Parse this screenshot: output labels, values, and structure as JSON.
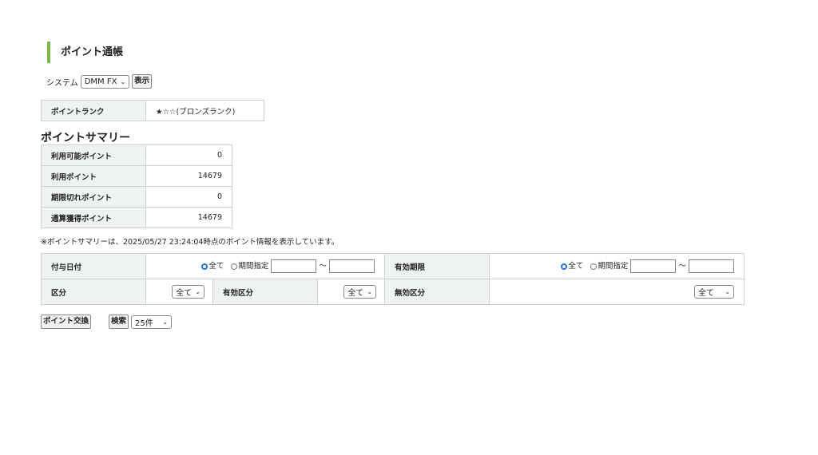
{
  "page_title": "ポイント通帳",
  "system": {
    "label": "システム",
    "selected": "DMM FX",
    "show_button": "表示"
  },
  "rank": {
    "label": "ポイントランク",
    "value": "★☆☆(ブロンズランク)"
  },
  "summary": {
    "title": "ポイントサマリー",
    "rows": [
      {
        "label": "利用可能ポイント",
        "value": "0"
      },
      {
        "label": "利用ポイント",
        "value": "14679"
      },
      {
        "label": "期限切れポイント",
        "value": "0"
      },
      {
        "label": "通算獲得ポイント",
        "value": "14679"
      }
    ],
    "note": "※ポイントサマリーは、2025/05/27 23:24:04時点のポイント情報を表示しています。"
  },
  "filters": {
    "grant_date": {
      "label": "付与日付",
      "opt_all": "全て",
      "opt_range": "期間指定",
      "sep": "～"
    },
    "expiry": {
      "label": "有効期限",
      "opt_all": "全て",
      "opt_range": "期間指定",
      "sep": "～"
    },
    "category": {
      "label": "区分",
      "selected": "全て"
    },
    "valid_category": {
      "label": "有効区分",
      "selected": "全て"
    },
    "invalid_category": {
      "label": "無効区分",
      "selected": "全て"
    }
  },
  "actions": {
    "exchange_button": "ポイント交換",
    "search_button": "検索",
    "per_page": "25件"
  },
  "colors": {
    "accent_bar": "#7ab648",
    "label_bg": "#eef3ef",
    "radio": "#2b6fd6"
  }
}
